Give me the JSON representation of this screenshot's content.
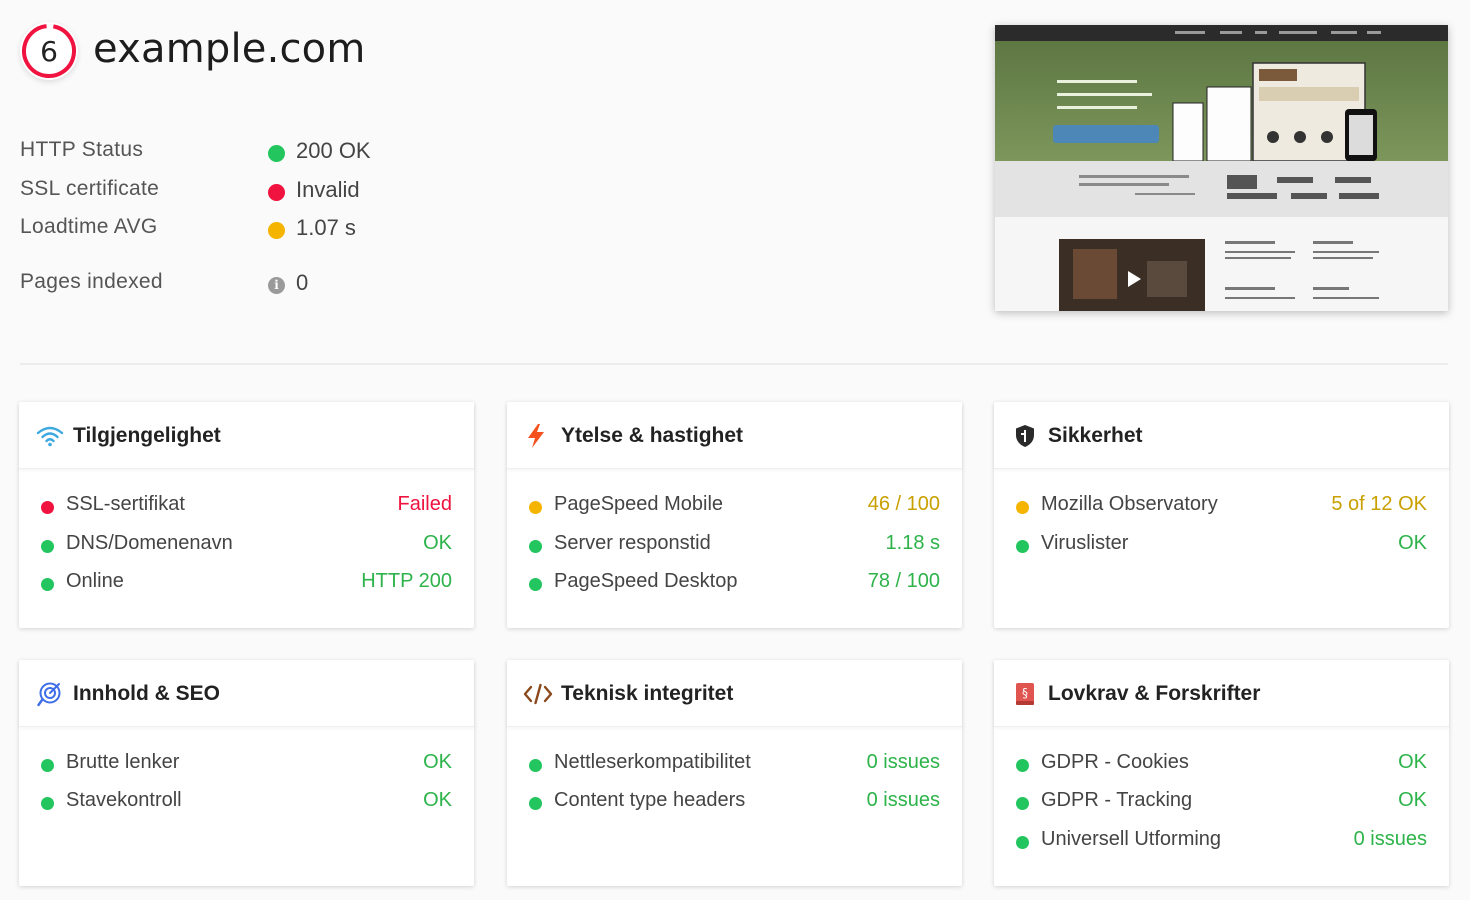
{
  "header": {
    "score": "6",
    "site": "example.com"
  },
  "stats": [
    {
      "label": "HTTP Status",
      "value": "200 OK",
      "status": "green"
    },
    {
      "label": "SSL certificate",
      "value": "Invalid",
      "status": "red"
    },
    {
      "label": "Loadtime AVG",
      "value": "1.07 s",
      "status": "yellow"
    },
    {
      "label": "Pages indexed",
      "value": "0",
      "status": "info"
    }
  ],
  "colors": {
    "ok": "#22c55e",
    "fail": "#f0123f",
    "warn": "#f5b400",
    "info": "#9a9a9a"
  },
  "cards": [
    {
      "title": "Tilgjengelighet",
      "icon": "wifi-icon",
      "checks": [
        {
          "label": "SSL-sertifikat",
          "value": "Failed",
          "status": "red"
        },
        {
          "label": "DNS/Domenenavn",
          "value": "OK",
          "status": "green"
        },
        {
          "label": "Online",
          "value": "HTTP 200",
          "status": "green"
        }
      ]
    },
    {
      "title": "Ytelse & hastighet",
      "icon": "lightning-icon",
      "checks": [
        {
          "label": "PageSpeed Mobile",
          "value": "46 / 100",
          "status": "yellow"
        },
        {
          "label": "Server responstid",
          "value": "1.18 s",
          "status": "green"
        },
        {
          "label": "PageSpeed Desktop",
          "value": "78 / 100",
          "status": "green"
        }
      ]
    },
    {
      "title": "Sikkerhet",
      "icon": "shield-icon",
      "checks": [
        {
          "label": "Mozilla Observatory",
          "value": "5 of 12 OK",
          "status": "yellow"
        },
        {
          "label": "Viruslister",
          "value": "OK",
          "status": "green"
        }
      ]
    },
    {
      "title": "Innhold & SEO",
      "icon": "seo-icon",
      "checks": [
        {
          "label": "Brutte lenker",
          "value": "OK",
          "status": "green"
        },
        {
          "label": "Stavekontroll",
          "value": "OK",
          "status": "green"
        }
      ]
    },
    {
      "title": "Teknisk integritet",
      "icon": "code-icon",
      "checks": [
        {
          "label": "Nettleserkompatibilitet",
          "value": "0 issues",
          "status": "green"
        },
        {
          "label": "Content type headers",
          "value": "0 issues",
          "status": "green"
        }
      ]
    },
    {
      "title": "Lovkrav & Forskrifter",
      "icon": "law-book-icon",
      "checks": [
        {
          "label": "GDPR - Cookies",
          "value": "OK",
          "status": "green"
        },
        {
          "label": "GDPR - Tracking",
          "value": "OK",
          "status": "green"
        },
        {
          "label": "Universell Utforming",
          "value": "0 issues",
          "status": "green"
        }
      ]
    }
  ]
}
